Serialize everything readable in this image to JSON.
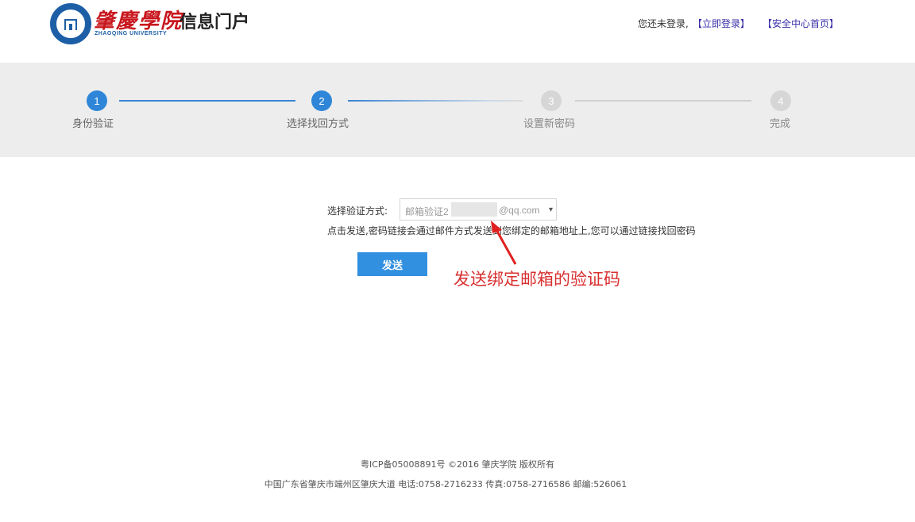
{
  "header": {
    "brand_cn": "肇慶學院",
    "brand_en": "ZHAOQING UNIVERSITY",
    "portal_title": "信息门户",
    "login_status": "您还未登录,",
    "login_link": "【立即登录】",
    "security_home_link": "【安全中心首页】"
  },
  "steps": [
    {
      "number": "1",
      "label": "身份验证",
      "state": "completed"
    },
    {
      "number": "2",
      "label": "选择找回方式",
      "state": "current"
    },
    {
      "number": "3",
      "label": "设置新密码",
      "state": "pending"
    },
    {
      "number": "4",
      "label": "完成",
      "state": "pending"
    }
  ],
  "form": {
    "method_label": "选择验证方式:",
    "method_select_value_prefix": "邮箱验证2",
    "method_select_value_suffix": "@qq.com",
    "hint": "点击发送,密码链接会通过邮件方式发送到您绑定的邮箱地址上,您可以通过链接找回密码",
    "send_button": "发送"
  },
  "annotation": {
    "text": "发送绑定邮箱的验证码",
    "color": "#d93030"
  },
  "footer": {
    "line1": "粤ICP备05008891号 ©2016 肇庆学院 版权所有",
    "line2": "中国广东省肇庆市端州区肇庆大道 电话:0758-2716233 传真:0758-2716586 邮编:526061"
  },
  "colors": {
    "accent": "#2f86d8",
    "step_bar_bg": "#ededed",
    "brand_red": "#c8161d",
    "link": "#3a2ea8"
  }
}
